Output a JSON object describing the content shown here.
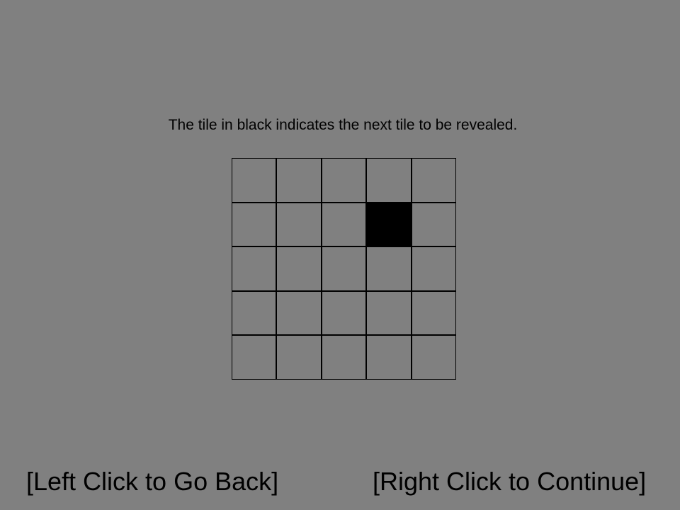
{
  "instruction": "The tile in black indicates the next tile to be revealed.",
  "grid": {
    "rows": 5,
    "cols": 5,
    "highlighted_tile": {
      "row": 2,
      "col": 4
    },
    "tile_color": "#808080",
    "highlight_color": "#000000"
  },
  "navigation": {
    "back_label": "[Left Click to Go Back]",
    "continue_label": "[Right Click to Continue]"
  },
  "colors": {
    "background": "#808080",
    "text": "#000000"
  }
}
